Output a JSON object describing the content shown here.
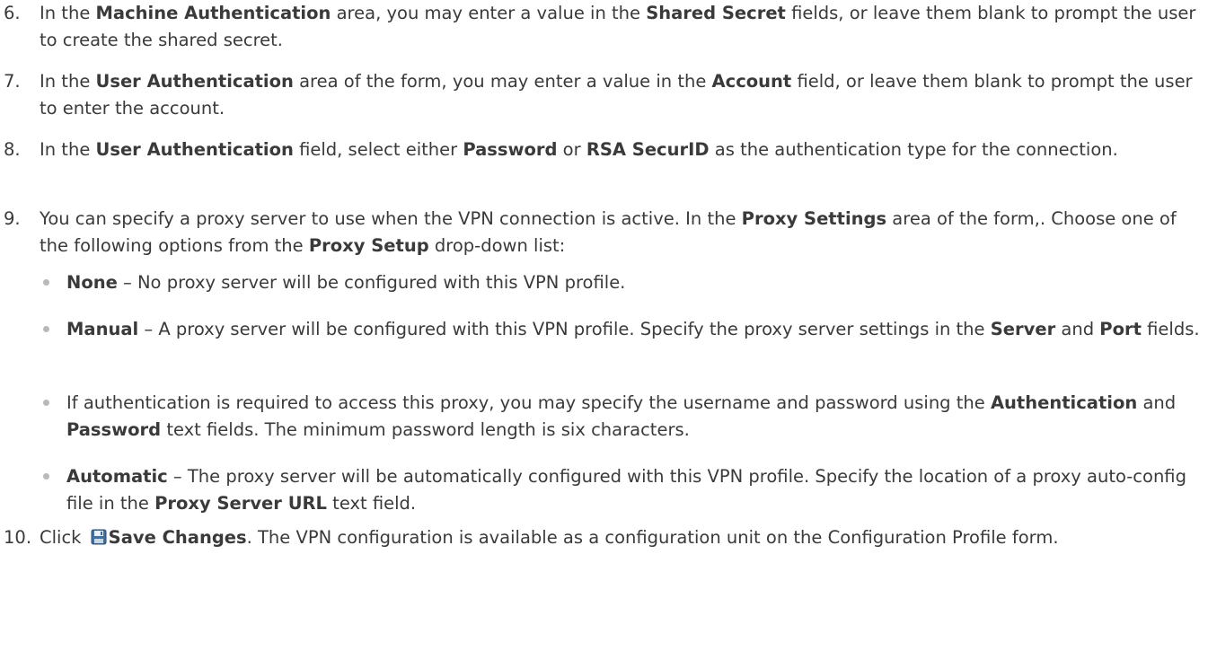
{
  "steps": {
    "s6": {
      "num": "6.",
      "t1": "In the ",
      "b1": "Machine Authentication",
      "t2": " area, you may enter a value in the ",
      "b2": "Shared Secret",
      "t3": " fields, or leave them blank to prompt the user to create the shared secret."
    },
    "s7": {
      "num": "7.",
      "t1": "In the ",
      "b1": "User Authentication",
      "t2": " area of the form, you may enter a value in the ",
      "b2": "Account",
      "t3": " field, or leave them blank to prompt the user to enter the account."
    },
    "s8": {
      "num": "8.",
      "t1": "In the ",
      "b1": "User Authentication",
      "t2": " field, select either ",
      "b2": "Password",
      "t3": " or ",
      "b3": "RSA SecurID",
      "t4": " as the authentication type for the connection."
    },
    "s9": {
      "num": "9.",
      "t1": "You can specify a proxy server to use when the VPN connection is active. In the ",
      "b1": "Proxy Settings",
      "t2": " area of the form,. Choose one of the following options from the ",
      "b2": "Proxy Setup",
      "t3": " drop-down list:"
    },
    "s10": {
      "num": "10.",
      "t1": "Click ",
      "b1": "Save Changes",
      "t2": ". The VPN configuration is available as a configuration unit on the Configuration Profile form."
    }
  },
  "bullets": {
    "none": {
      "b1": "None",
      "t1": " – No proxy server will be configured with this VPN profile."
    },
    "manual": {
      "b1": "Manual",
      "t1": " – A proxy server will be configured with this VPN profile. Specify the proxy server settings in the ",
      "b2": "Server",
      "t2": " and ",
      "b3": "Port",
      "t3": " fields."
    },
    "auth": {
      "t1": "If authentication is required to access this proxy, you may specify the username and password using the ",
      "b1": "Authentication",
      "t2": " and ",
      "b2": "Password",
      "t3": " text fields. The minimum password length is six characters."
    },
    "automatic": {
      "b1": "Automatic",
      "t1": " – The proxy server will be automatically configured with this VPN profile. Specify the location of a proxy auto-config file in the ",
      "b2": "Proxy Server URL",
      "t2": " text field."
    }
  },
  "icons": {
    "save": "save-icon"
  },
  "colors": {
    "text": "#3a3a3a",
    "bullet": "#b9b9b9"
  }
}
